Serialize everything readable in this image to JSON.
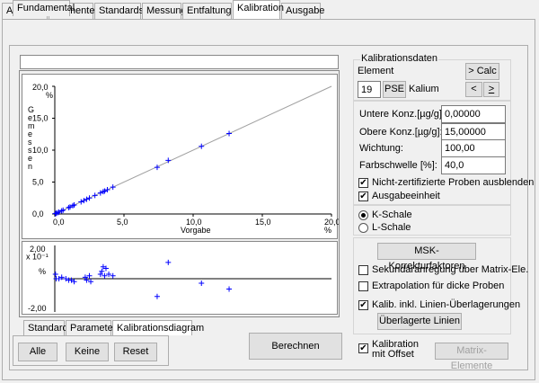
{
  "tabs": [
    "Allgemein",
    "Elemente",
    "Standards",
    "Messung",
    "Entfaltung",
    "Kalibration",
    "Ausgabe"
  ],
  "active_tab": "Kalibration",
  "subtab": "Fundamental",
  "bottom_tabs": [
    "Standards",
    "Parameter",
    "Kalibrationsdiagram"
  ],
  "buttons": {
    "alle": "Alle",
    "keine": "Keine",
    "reset": "Reset",
    "berechnen": "Berechnen",
    "calc": "> Calc",
    "prev": "<",
    "next": ">",
    "pse": "PSE",
    "msk": "MSK-Korrekturfaktoren",
    "ueberlagerte": "Überlagerte Linien",
    "matrix": "Matrix-Elemente"
  },
  "kalib": {
    "group_title": "Kalibrationsdaten",
    "element_label": "Element",
    "element_number": "19",
    "element_name": "Kalium"
  },
  "fields": {
    "untere_label": "Untere Konz.[µg/g]:",
    "untere_value": "0,00000",
    "obere_label": "Obere Konz.[µg/g]:",
    "obere_value": "15,00000",
    "wichtung_label": "Wichtung:",
    "wichtung_value": "100,00",
    "farb_label": "Farbschwelle [%]:",
    "farb_value": "40,0"
  },
  "checks": {
    "nicht_zert": "Nicht-zertifizierte Proben ausblenden",
    "ausgabe": "Ausgabeeinheit",
    "sekundaer": "Sekundäranregung über Matrix-Ele.",
    "extrapolation": "Extrapolation für dicke Proben",
    "kalib_linien": "Kalib. inkl. Linien-Überlagerungen",
    "kalib_offset": "Kalibration\nmit Offset"
  },
  "radios": {
    "k": "K-Schale",
    "l": "L-Schale"
  },
  "chart_data": [
    {
      "type": "scatter",
      "xlabel": "Vorgabe",
      "ylabel": "Gemessen",
      "xunit": "%",
      "yunit": "%",
      "xlim": [
        0,
        20
      ],
      "ylim": [
        0,
        20
      ],
      "xticks": [
        "0,0",
        "5,0",
        "10,0",
        "15,0",
        "20,0"
      ],
      "yticks": [
        "0,0",
        "5,0",
        "10,0",
        "15,0",
        "20,0"
      ],
      "fit_line": [
        [
          0,
          0
        ],
        [
          20,
          20
        ]
      ],
      "points": [
        [
          0.05,
          0.05
        ],
        [
          0.1,
          0.1
        ],
        [
          0.2,
          0.2
        ],
        [
          0.3,
          0.3
        ],
        [
          0.5,
          0.5
        ],
        [
          0.6,
          0.6
        ],
        [
          1.0,
          1.0
        ],
        [
          1.1,
          1.1
        ],
        [
          1.3,
          1.3
        ],
        [
          1.4,
          1.4
        ],
        [
          1.9,
          1.9
        ],
        [
          2.1,
          2.1
        ],
        [
          2.3,
          2.3
        ],
        [
          2.5,
          2.5
        ],
        [
          2.9,
          2.9
        ],
        [
          3.3,
          3.3
        ],
        [
          3.5,
          3.5
        ],
        [
          3.6,
          3.6
        ],
        [
          3.8,
          3.8
        ],
        [
          4.2,
          4.2
        ],
        [
          7.4,
          7.3
        ],
        [
          8.2,
          8.4
        ],
        [
          10.6,
          10.6
        ],
        [
          12.6,
          12.6
        ]
      ]
    },
    {
      "type": "scatter",
      "ylabel": "x 10⁻¹ %",
      "ylim": [
        -2,
        2
      ],
      "yticks": [
        "2,00",
        "-2,00"
      ],
      "y_scale": "x 10^-1",
      "points": [
        [
          0.05,
          0.3
        ],
        [
          0.1,
          0.0
        ],
        [
          0.3,
          0.0
        ],
        [
          0.5,
          0.1
        ],
        [
          0.8,
          0.0
        ],
        [
          1.0,
          -0.1
        ],
        [
          1.2,
          -0.1
        ],
        [
          1.4,
          -0.2
        ],
        [
          2.2,
          0.1
        ],
        [
          2.3,
          -0.1
        ],
        [
          2.5,
          0.2
        ],
        [
          2.6,
          -0.2
        ],
        [
          3.3,
          0.3
        ],
        [
          3.4,
          0.5
        ],
        [
          3.5,
          0.8
        ],
        [
          3.6,
          0.2
        ],
        [
          3.7,
          0.7
        ],
        [
          3.9,
          0.3
        ],
        [
          4.2,
          0.2
        ],
        [
          7.4,
          -1.2
        ],
        [
          8.2,
          1.1
        ],
        [
          10.6,
          -0.3
        ],
        [
          12.6,
          -0.7
        ]
      ]
    }
  ]
}
